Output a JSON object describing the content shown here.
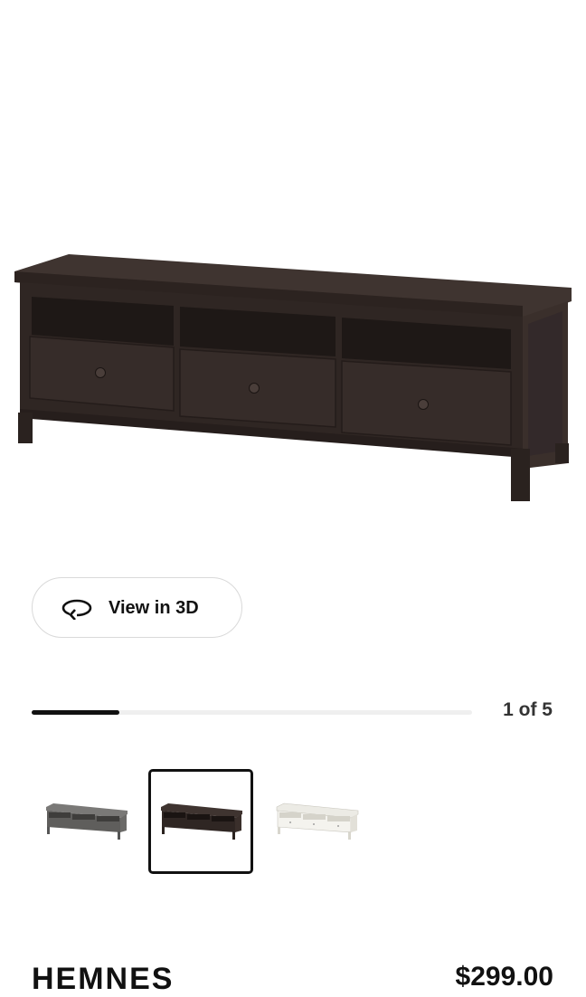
{
  "hero": {
    "image_alt": "HEMNES TV unit, black-brown",
    "wood_color": "#3b302b"
  },
  "view3d": {
    "label": "View in 3D",
    "icon": "rotate-3d-icon"
  },
  "gallery": {
    "counter_text": "1 of 5",
    "current_index": 1,
    "total": 5,
    "progress_fraction": 0.2,
    "thumbnails": [
      {
        "color_name": "gray-stained",
        "wood_color": "#6e6d6b",
        "selected": false
      },
      {
        "color_name": "black-brown",
        "wood_color": "#3b302b",
        "selected": true
      },
      {
        "color_name": "white-stain",
        "wood_color": "#f1efe8",
        "selected": false
      }
    ]
  },
  "product": {
    "name": "HEMNES",
    "price": "$299.00"
  }
}
